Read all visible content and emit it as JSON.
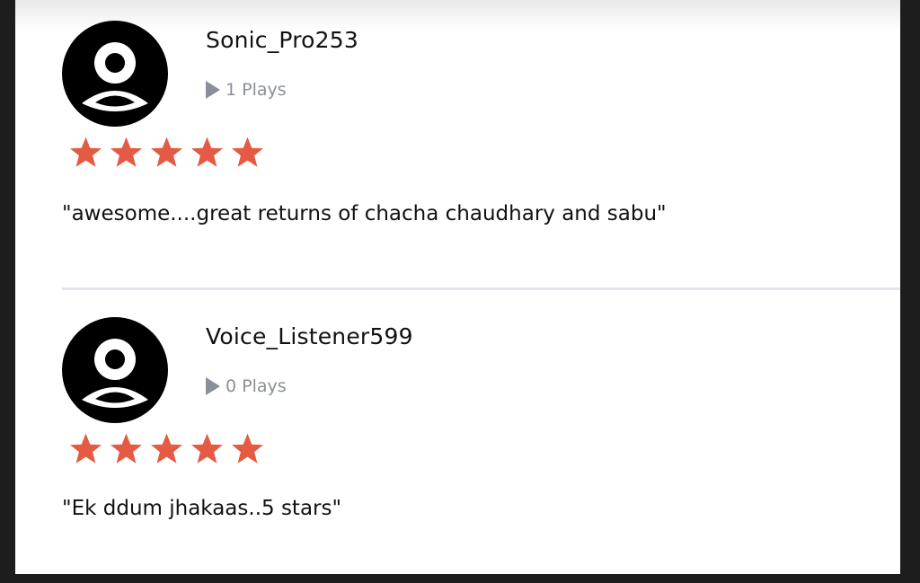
{
  "reviews": [
    {
      "username": "Sonic_Pro253",
      "plays": "1 Plays",
      "rating": 5,
      "comment": "\"awesome....great returns of chacha chaudhary and sabu\""
    },
    {
      "username": "Voice_Listener599",
      "plays": "0 Plays",
      "rating": 5,
      "comment": "\"Ek ddum jhakaas..5 stars\""
    }
  ],
  "colors": {
    "star": "#e45a42",
    "avatar_bg": "#000000",
    "plays_text": "#8a8f99",
    "divider": "#e4e6ee"
  },
  "icons": {
    "avatar": "person-avatar-icon",
    "plays": "play-triangle-icon",
    "rating": "star-icon"
  }
}
